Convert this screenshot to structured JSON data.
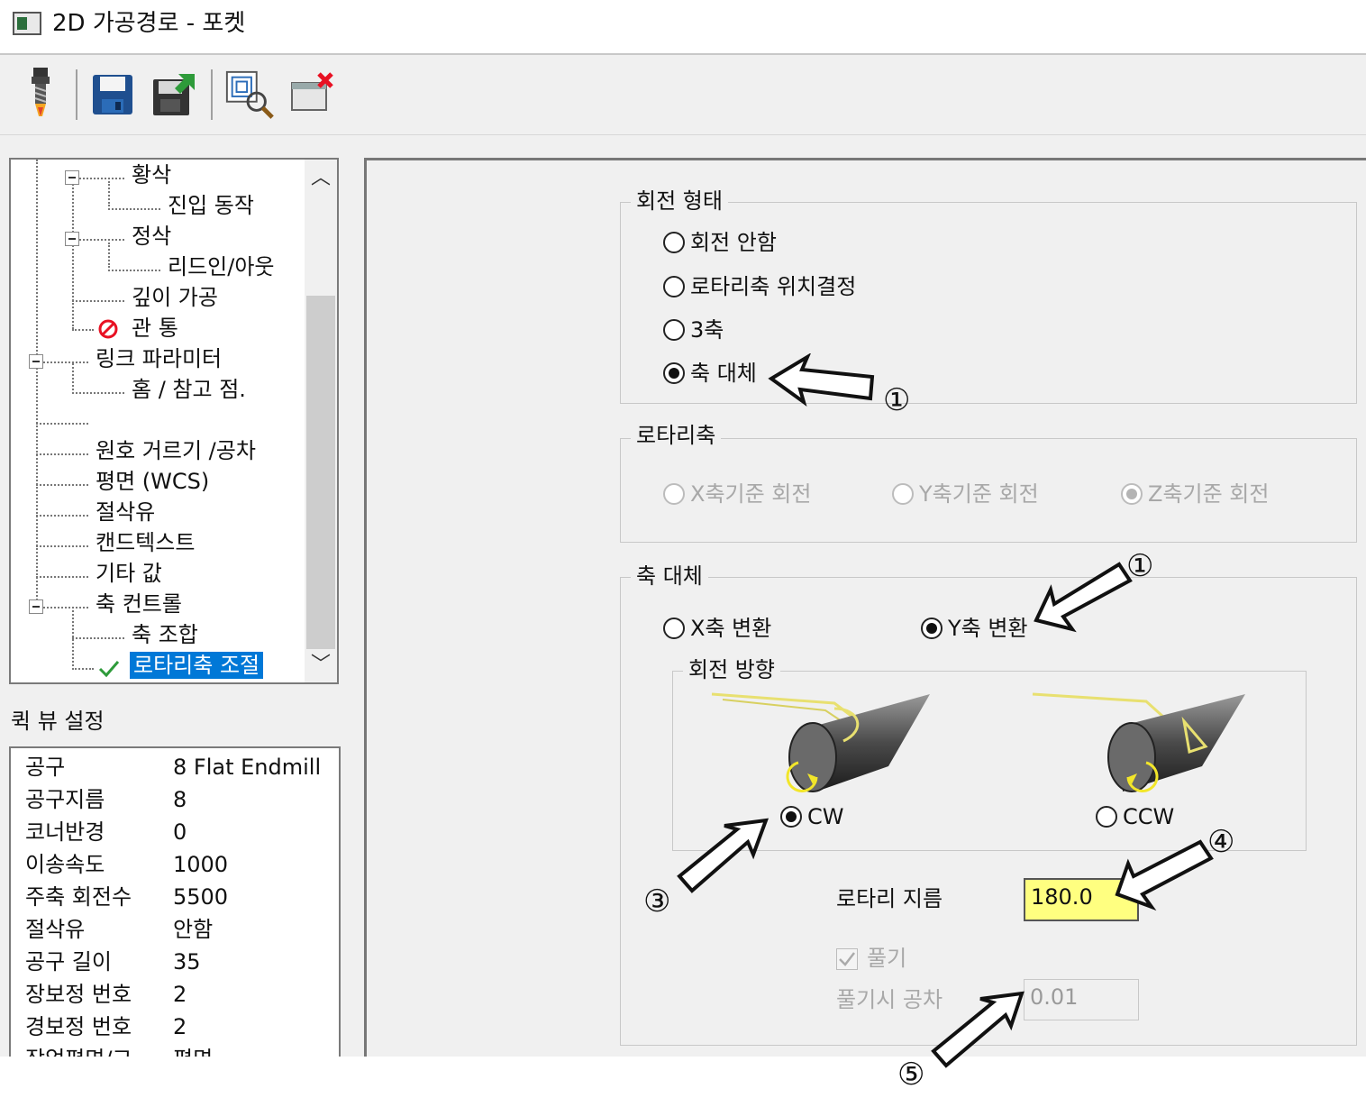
{
  "window": {
    "title": "2D 가공경로 - 포켓"
  },
  "toolbar": {
    "buttons": [
      "tool-icon",
      "save-icon",
      "save-as-icon",
      "preview-icon",
      "close-window-icon"
    ]
  },
  "tree": {
    "items": [
      {
        "label": "황삭"
      },
      {
        "label": "진입 동작"
      },
      {
        "label": "정삭"
      },
      {
        "label": "리드인/아웃"
      },
      {
        "label": "깊이 가공"
      },
      {
        "label": "관 통"
      },
      {
        "label": "링크 파라미터"
      },
      {
        "label": "홈 / 참고 점."
      },
      {
        "label": "원호 거르기 /공차"
      },
      {
        "label": "평면 (WCS)"
      },
      {
        "label": "절삭유"
      },
      {
        "label": "캔드텍스트"
      },
      {
        "label": "기타 값"
      },
      {
        "label": "축 컨트롤"
      },
      {
        "label": "축 조합"
      },
      {
        "label": "로타리축 조절"
      }
    ]
  },
  "quick_view": {
    "title": "퀵 뷰 설정",
    "rows": [
      {
        "key": "공구",
        "value": "8 Flat Endmill"
      },
      {
        "key": "공구지름",
        "value": "8"
      },
      {
        "key": "코너반경",
        "value": "0"
      },
      {
        "key": "이송속도",
        "value": "1000"
      },
      {
        "key": "주축 회전수",
        "value": "5500"
      },
      {
        "key": "절삭유",
        "value": "안함"
      },
      {
        "key": "공구 길이",
        "value": "35"
      },
      {
        "key": "장보정 번호",
        "value": "2"
      },
      {
        "key": "경보정 번호",
        "value": "2"
      },
      {
        "key": "작업평면/고",
        "value": "평면"
      }
    ]
  },
  "rotation_type": {
    "title": "회전 형태",
    "options": [
      "회전 안함",
      "로타리축 위치결정",
      "3축",
      "축 대체"
    ],
    "selected": "축 대체"
  },
  "rotary_axis": {
    "title": "로타리축",
    "options": [
      "X축기준 회전",
      "Y축기준 회전",
      "Z축기준 회전"
    ],
    "selected": "Z축기준 회전"
  },
  "axis_substitution": {
    "title": "축 대체",
    "options": [
      "X축 변환",
      "Y축 변환"
    ],
    "selected": "Y축 변환",
    "rotation_direction": {
      "title": "회전 방향",
      "options": [
        "CW",
        "CCW"
      ],
      "selected": "CW"
    },
    "rotary_diameter": {
      "label": "로타리 지름",
      "value": "180.0"
    },
    "unwrap": {
      "label": "풀기",
      "checked": true
    },
    "unwrap_tolerance": {
      "label": "풀기시 공차",
      "value": "0.01"
    }
  },
  "callouts": [
    "①",
    "①",
    "③",
    "④",
    "⑤"
  ],
  "colors": {
    "highlight_field": "#ffff80",
    "selection": "#0078d7",
    "error_icon": "#e81123",
    "ok_icon": "#2e9b3a"
  }
}
